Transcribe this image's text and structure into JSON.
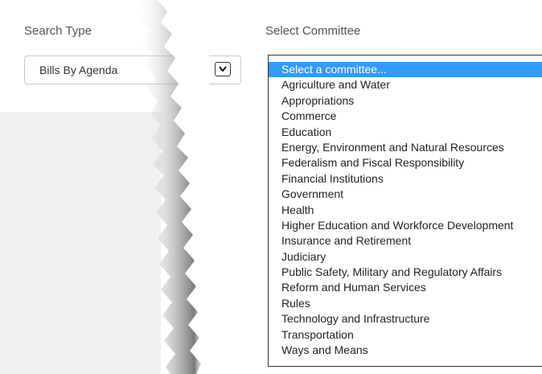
{
  "search_type": {
    "label": "Search Type",
    "selected_value": "Bills By Agenda",
    "arrow_icon": "chevron-down-icon"
  },
  "committee": {
    "label": "Select Committee",
    "options": [
      "Select a committee...",
      "Agriculture and Water",
      "Appropriations",
      "Commerce",
      "Education",
      "Energy, Environment and Natural Resources",
      "Federalism and Fiscal Responsibility",
      "Financial Institutions",
      "Government",
      "Health",
      "Higher Education and Workforce Development",
      "Insurance and Retirement",
      "Judiciary",
      "Public Safety, Military and Regulatory Affairs",
      "Reform and Human Services",
      "Rules",
      "Technology and Infrastructure",
      "Transportation",
      "Ways and Means"
    ],
    "highlighted_index": 0
  },
  "colors": {
    "highlight": "#3399ff",
    "panel_gray": "#f0f0f0"
  }
}
